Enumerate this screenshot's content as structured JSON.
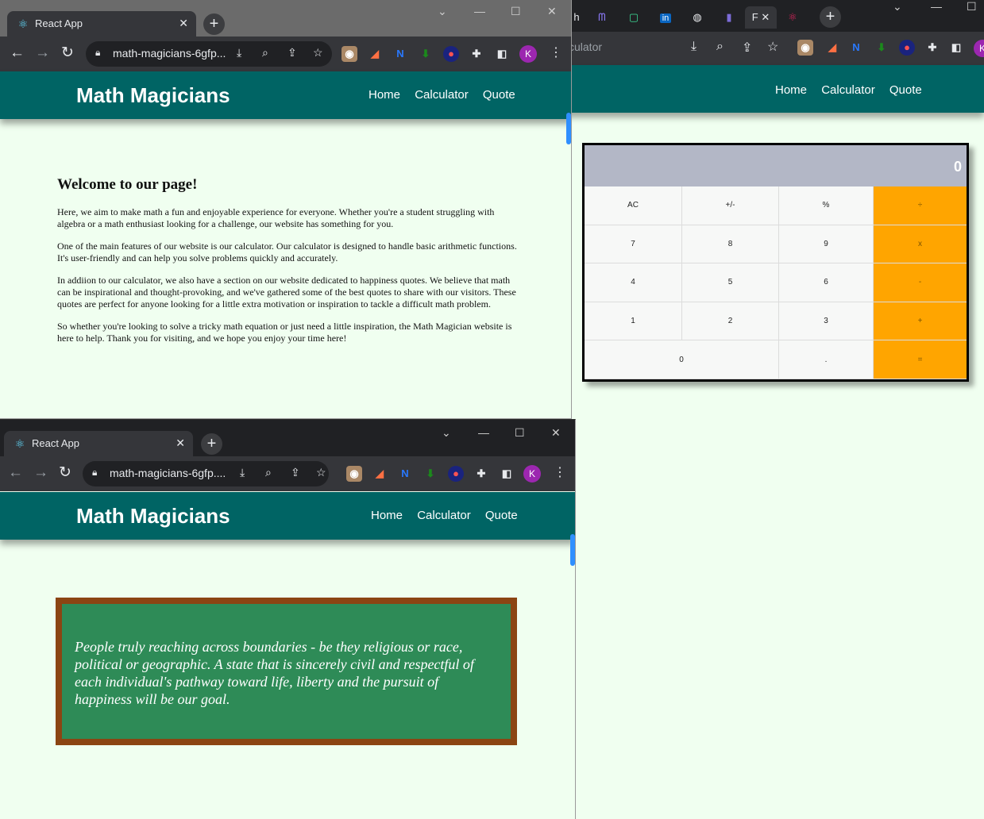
{
  "top_window": {
    "tab_title": "React App",
    "url": "math-magicians-6gfp...",
    "avatar": "K",
    "brand": "Math Magicians",
    "nav": [
      "Home",
      "Calculator",
      "Quote"
    ],
    "welcome": {
      "heading": "Welcome to our page!",
      "paragraphs": [
        "Here, we aim to make math a fun and enjoyable experience for everyone. Whether you're a student struggling with algebra or a math enthusiast looking for a challenge, our website has something for you.",
        "One of the main features of our website is our calculator. Our calculator is designed to handle basic arithmetic functions. It's user-friendly and can help you solve problems quickly and accurately.",
        "In addiion to our calculator, we also have a section on our website dedicated to happiness quotes. We believe that math can be inspirational and thought-provoking, and we've gathered some of the best quotes to share with our visitors. These quotes are perfect for anyone looking for a little extra motivation or inspiration to tackle a difficult math problem.",
        "So whether you're looking to solve a tricky math equation or just need a little inspiration, the Math Magician website is here to help. Thank you for visiting, and we hope you enjoy your time here!"
      ]
    }
  },
  "right_window": {
    "url_fragment": "culator",
    "nav": [
      "Home",
      "Calculator",
      "Quote"
    ],
    "active_tab_letter": "F",
    "avatar": "K",
    "calculator": {
      "display": "0",
      "keys": [
        "AC",
        "+/-",
        "%",
        "÷",
        "7",
        "8",
        "9",
        "x",
        "4",
        "5",
        "6",
        "-",
        "1",
        "2",
        "3",
        "+",
        "0",
        ".",
        "="
      ]
    }
  },
  "bottom_window": {
    "tab_title": "React App",
    "url": "math-magicians-6gfp....",
    "avatar": "K",
    "brand": "Math Magicians",
    "nav": [
      "Home",
      "Calculator",
      "Quote"
    ],
    "quote": "People truly reaching across boundaries - be they religious or race, political or geographic. A state that is sincerely civil and respectful of each individual's pathway toward life, liberty and the pursuit of happiness will be our goal."
  },
  "colors": {
    "nav_bg": "#006464",
    "page_bg": "#f0fff0",
    "display_bg": "#b3b7c6",
    "operator_bg": "#ffa500",
    "quote_bg": "#2e8b57",
    "quote_border": "#8b4513"
  }
}
